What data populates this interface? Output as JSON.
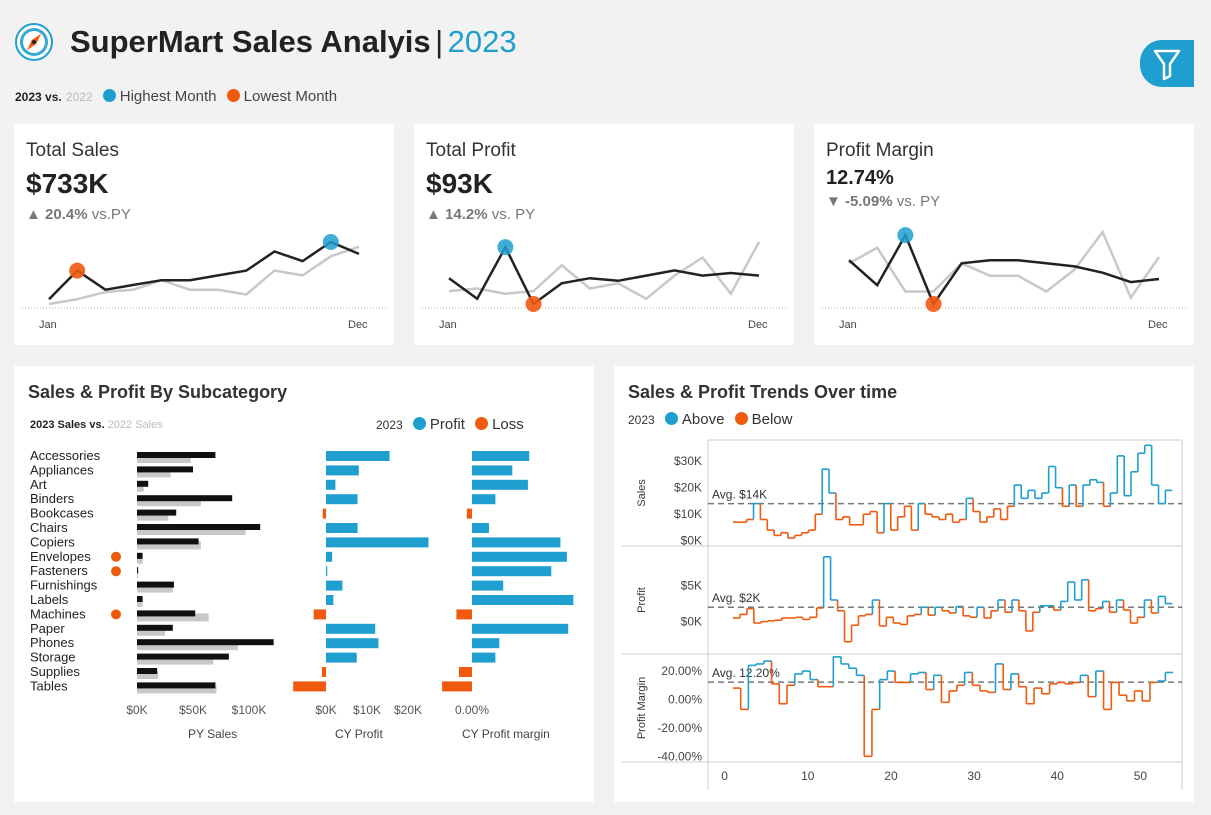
{
  "header": {
    "title": "SuperMart Sales Analyis",
    "separator": "|",
    "year": "2023",
    "legend": {
      "current_year": "2023 vs.",
      "previous_year": "2022",
      "highest": "Highest Month",
      "lowest": "Lowest Month"
    },
    "filter_icon": "filter-icon",
    "logo_icon": "compass-icon"
  },
  "colors": {
    "accent_blue": "#1f9fcf",
    "accent_orange": "#f05a0f",
    "current": "#222222",
    "previous": "#c8c8c8"
  },
  "kpis": [
    {
      "title": "Total Sales",
      "value": "$733K",
      "delta_arrow": "▲",
      "delta_value": "20.4%",
      "delta_suffix": "vs.PY",
      "axis_start": "Jan",
      "axis_end": "Dec",
      "cy": [
        12,
        24,
        16,
        18,
        20,
        20,
        22,
        24,
        32,
        28,
        36,
        31
      ],
      "py": [
        10,
        12,
        15,
        16,
        20,
        16,
        16,
        14,
        24,
        22,
        30,
        34
      ],
      "high_month": 10,
      "low_month": 1
    },
    {
      "title": "Total Profit",
      "value": "$93K",
      "delta_arrow": "▲",
      "delta_value": "14.2%",
      "delta_suffix": "vs. PY",
      "axis_start": "Jan",
      "axis_end": "Dec",
      "cy": [
        9,
        1,
        21,
        -1,
        7,
        9,
        8,
        10,
        12,
        10,
        11,
        10
      ],
      "py": [
        4,
        5,
        3,
        4,
        14,
        5,
        7,
        1,
        10,
        17,
        3,
        23
      ],
      "high_month": 2,
      "low_month": 3
    },
    {
      "title": "Profit Margin",
      "value": "12.74%",
      "delta_arrow": "▼",
      "delta_value": "-5.09%",
      "delta_suffix": "vs. PY",
      "axis_start": "Jan",
      "axis_end": "Dec",
      "cy": [
        15,
        7,
        23,
        1,
        14,
        15,
        15,
        14,
        13,
        11,
        8,
        9
      ],
      "py": [
        14,
        19,
        5,
        5,
        14,
        10,
        10,
        5,
        12,
        24,
        3,
        16
      ],
      "high_month": 2,
      "low_month": 3
    }
  ],
  "subcategory": {
    "title": "Sales & Profit By Subcategory",
    "legend_current": "2023 Sales vs.",
    "legend_previous": "2022 Sales",
    "legend_year": "2023",
    "legend_profit": "Profit",
    "legend_loss": "Loss",
    "col_py_sales": "PY Sales",
    "col_cy_profit": "CY Profit",
    "col_margin": "CY Profit margin",
    "py_ticks": [
      "$0K",
      "$50K",
      "$100K"
    ],
    "profit_ticks": [
      "$0K",
      "$10K",
      "$20K"
    ],
    "margin_ticks": [
      "0.00%"
    ]
  },
  "trends": {
    "title": "Sales & Profit Trends Over time",
    "legend_year": "2023",
    "legend_above": "Above",
    "legend_below": "Below",
    "sales": {
      "label": "Sales",
      "avg_label": "Avg. $14K",
      "ticks": [
        "$30K",
        "$20K",
        "$10K",
        "$0K"
      ]
    },
    "profit": {
      "label": "Profit",
      "avg_label": "Avg. $2K",
      "ticks": [
        "$5K",
        "$0K"
      ]
    },
    "margin": {
      "label": "Profit Margin",
      "avg_label": "Avg. 12.20%",
      "ticks": [
        "20.00%",
        "0.00%",
        "-20.00%",
        "-40.00%"
      ]
    },
    "x_ticks": [
      "0",
      "10",
      "20",
      "30",
      "40",
      "50"
    ]
  },
  "chart_data": [
    {
      "type": "bar",
      "title": "Sales & Profit By Subcategory",
      "categories": [
        "Accessories",
        "Appliances",
        "Art",
        "Binders",
        "Bookcases",
        "Chairs",
        "Copiers",
        "Envelopes",
        "Fasteners",
        "Furnishings",
        "Labels",
        "Machines",
        "Paper",
        "Phones",
        "Storage",
        "Supplies",
        "Tables"
      ],
      "loss_markers": [
        "Envelopes",
        "Fasteners",
        "Machines"
      ],
      "series": [
        {
          "name": "2023 Sales",
          "values": [
            70,
            50,
            10,
            85,
            35,
            110,
            55,
            5,
            1,
            33,
            5,
            52,
            32,
            122,
            82,
            18,
            70
          ]
        },
        {
          "name": "2022 Sales",
          "values": [
            48,
            30,
            6,
            57,
            28,
            97,
            57,
            5,
            1,
            32,
            5,
            64,
            25,
            90,
            68,
            19,
            71
          ]
        },
        {
          "name": "CY Profit",
          "values": [
            15.5,
            8,
            2.3,
            7.7,
            -0.8,
            7.7,
            25,
            1.5,
            0.3,
            4,
            1.8,
            -3,
            12,
            12.8,
            7.5,
            -1,
            -8
          ]
        },
        {
          "name": "CY Profit margin",
          "values": [
            22,
            15.5,
            21.5,
            9,
            -2,
            6.5,
            34,
            36.5,
            30.5,
            12,
            39,
            -6,
            37,
            10.5,
            9,
            -5,
            -11.5
          ]
        }
      ]
    },
    {
      "type": "line",
      "title": "Sales & Profit Trends Over time",
      "x": [
        1,
        2,
        3,
        4,
        5,
        6,
        7,
        8,
        9,
        10,
        11,
        12,
        13,
        14,
        15,
        16,
        17,
        18,
        19,
        20,
        21,
        22,
        23,
        24,
        25,
        26,
        27,
        28,
        29,
        30,
        31,
        32,
        33,
        34,
        35,
        36,
        37,
        38,
        39,
        40,
        41,
        42,
        43,
        44,
        45,
        46,
        47,
        48,
        49,
        50,
        51,
        52,
        53
      ],
      "xlim": [
        -2,
        55
      ],
      "series": [
        {
          "name": "Sales",
          "ylim": [
            -2,
            38
          ],
          "avg": 14,
          "values": [
            7,
            7,
            8,
            14,
            8,
            4,
            2,
            3,
            1,
            2,
            3,
            4,
            10,
            27,
            18,
            8,
            9,
            6,
            6,
            10,
            11,
            3,
            14,
            4,
            9,
            13,
            4,
            14,
            10,
            9,
            8,
            10,
            7,
            8,
            16,
            11,
            7,
            9,
            12,
            8,
            13,
            21,
            16,
            19,
            16,
            18,
            28,
            20,
            13,
            21,
            13,
            21,
            23,
            22,
            13,
            18,
            32,
            17,
            26,
            33,
            36,
            21,
            14,
            19
          ]
        },
        {
          "name": "Profit",
          "ylim": [
            -4.5,
            10.5
          ],
          "avg": 2,
          "values": [
            0.5,
            1,
            1.8,
            -0.2,
            0,
            0.1,
            0.2,
            0.5,
            0.5,
            0.6,
            0.3,
            0.6,
            1.9,
            9,
            3,
            1.5,
            -2.8,
            -0.5,
            0.8,
            1,
            3,
            -0.6,
            0.6,
            -0.2,
            -0.4,
            0.8,
            1,
            2,
            0.9,
            2,
            1.5,
            1.2,
            2.1,
            0.8,
            0.6,
            2,
            0.5,
            1.5,
            3,
            1.3,
            3,
            1.5,
            -1.3,
            1.3,
            2.2,
            2.2,
            1.6,
            2.8,
            5.5,
            3,
            5.8,
            1.5,
            1.8,
            2.8,
            1.3,
            3,
            1.6,
            -0.2,
            0.6,
            3,
            1.2,
            3.5,
            2.5
          ]
        },
        {
          "name": "Profit Margin",
          "ylim": [
            -44,
            32
          ],
          "avg": 12.2,
          "values": [
            8,
            -7,
            24,
            25,
            27,
            11,
            -3,
            10,
            18,
            20,
            14,
            9,
            9,
            30,
            25,
            22,
            17,
            -40,
            -7,
            14,
            20,
            12,
            12,
            18,
            19,
            7,
            17,
            -2,
            6,
            10,
            19,
            10,
            6,
            5,
            25,
            7,
            18,
            9,
            -3,
            8,
            4,
            11,
            12,
            11,
            12,
            17,
            2,
            20,
            -7,
            12,
            3,
            -1,
            6,
            -1,
            12,
            13,
            19
          ]
        }
      ]
    }
  ]
}
